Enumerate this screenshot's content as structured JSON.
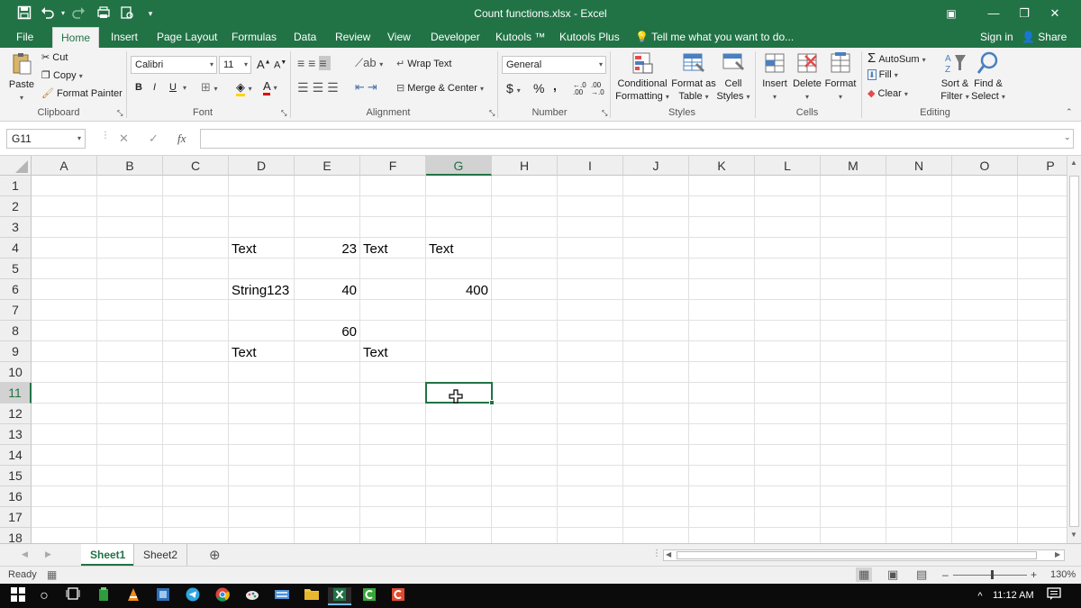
{
  "window": {
    "title": "Count functions.xlsx - Excel",
    "minimize_glyph": "—",
    "restore_glyph": "❐",
    "close_glyph": "✕",
    "ribbon_display_glyph": "▣"
  },
  "ribbon_tabs": [
    {
      "label": "File"
    },
    {
      "label": "Home"
    },
    {
      "label": "Insert"
    },
    {
      "label": "Page Layout"
    },
    {
      "label": "Formulas"
    },
    {
      "label": "Data"
    },
    {
      "label": "Review"
    },
    {
      "label": "View"
    },
    {
      "label": "Developer"
    },
    {
      "label": "Kutools ™"
    },
    {
      "label": "Kutools Plus"
    }
  ],
  "tell_me": "Tell me what you want to do...",
  "sign_in": "Sign in",
  "share": "Share",
  "clipboard": {
    "paste": "Paste",
    "cut": "Cut",
    "copy": "Copy",
    "format_painter": "Format Painter",
    "label": "Clipboard"
  },
  "font": {
    "name": "Calibri",
    "size": "11",
    "bold": "B",
    "italic": "I",
    "underline": "U",
    "grow": "A",
    "shrink": "A",
    "color_letter": "A",
    "label": "Font"
  },
  "alignment": {
    "wrap_text": "Wrap Text",
    "merge_center": "Merge & Center",
    "label": "Alignment"
  },
  "number": {
    "format": "General",
    "currency": "$",
    "percent": "%",
    "comma": ",",
    "increase_decimal": "←.0 .00",
    "decrease_decimal": ".00 →.0",
    "label": "Number"
  },
  "styles": {
    "conditional_formatting": [
      "Conditional",
      "Formatting"
    ],
    "format_as_table": [
      "Format as",
      "Table"
    ],
    "cell_styles": [
      "Cell",
      "Styles"
    ],
    "label": "Styles"
  },
  "cells": {
    "insert": "Insert",
    "delete": "Delete",
    "format": "Format",
    "label": "Cells"
  },
  "editing": {
    "autosum": "AutoSum",
    "fill": "Fill",
    "clear": "Clear",
    "sort_filter": [
      "Sort &",
      "Filter"
    ],
    "find_select": [
      "Find &",
      "Select"
    ],
    "label": "Editing"
  },
  "formula_bar": {
    "name_box": "G11",
    "cancel": "✕",
    "enter": "✓",
    "fx": "fx",
    "value": ""
  },
  "columns": [
    "A",
    "B",
    "C",
    "D",
    "E",
    "F",
    "G",
    "H",
    "I",
    "J",
    "K",
    "L",
    "M",
    "N",
    "O",
    "P"
  ],
  "rows": [
    "1",
    "2",
    "3",
    "4",
    "5",
    "6",
    "7",
    "8",
    "9",
    "10",
    "11",
    "12",
    "13",
    "14",
    "15",
    "16",
    "17",
    "18"
  ],
  "selected_column": "G",
  "selected_row": "11",
  "cells_data": [
    {
      "ref": "D4",
      "value": "Text",
      "type": "text"
    },
    {
      "ref": "E4",
      "value": "23",
      "type": "number"
    },
    {
      "ref": "F4",
      "value": "Text",
      "type": "text"
    },
    {
      "ref": "G4",
      "value": "Text",
      "type": "text"
    },
    {
      "ref": "D6",
      "value": "String123",
      "type": "text"
    },
    {
      "ref": "E6",
      "value": "40",
      "type": "number"
    },
    {
      "ref": "G6",
      "value": "400",
      "type": "number"
    },
    {
      "ref": "E8",
      "value": "60",
      "type": "number"
    },
    {
      "ref": "D9",
      "value": "Text",
      "type": "text"
    },
    {
      "ref": "F9",
      "value": "Text",
      "type": "text"
    }
  ],
  "sheets": [
    {
      "name": "Sheet1",
      "active": true
    },
    {
      "name": "Sheet2",
      "active": false
    }
  ],
  "add_sheet": "⊕",
  "status": {
    "ready": "Ready",
    "zoom": "130%",
    "minus": "–",
    "plus": "+"
  },
  "taskbar": {
    "time": "11:12 AM",
    "caret": "^"
  },
  "colors": {
    "excel_green": "#217346",
    "ribbon_bg": "#f3f3f3",
    "taskbar_bg": "#0b0b0b"
  }
}
